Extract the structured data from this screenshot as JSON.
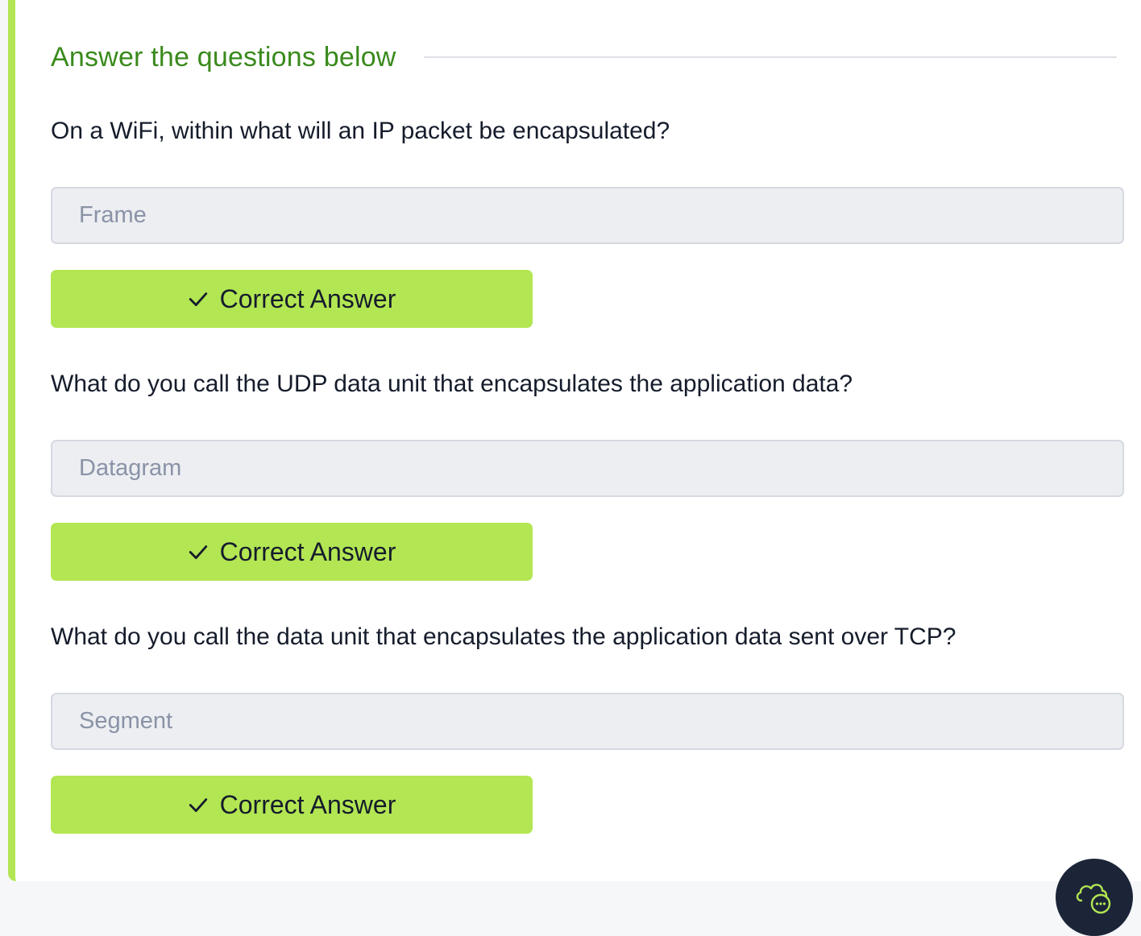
{
  "section": {
    "title": "Answer the questions below"
  },
  "questions": [
    {
      "text": "On a WiFi, within what will an IP packet be encapsulated?",
      "answer": "Frame",
      "button_label": "Correct Answer"
    },
    {
      "text": "What do you call the UDP data unit that encapsulates the application data?",
      "answer": "Datagram",
      "button_label": "Correct Answer"
    },
    {
      "text": "What do you call the data unit that encapsulates the application data sent over TCP?",
      "answer": "Segment",
      "button_label": "Correct Answer"
    }
  ],
  "icons": {
    "check": "check-icon",
    "chat": "cloud-chat-icon"
  },
  "colors": {
    "accent": "#b3e653",
    "title": "#3a8a1c",
    "answer_bg": "#eceef2",
    "answer_text": "#8a93a6",
    "fab_bg": "#1c2538"
  }
}
